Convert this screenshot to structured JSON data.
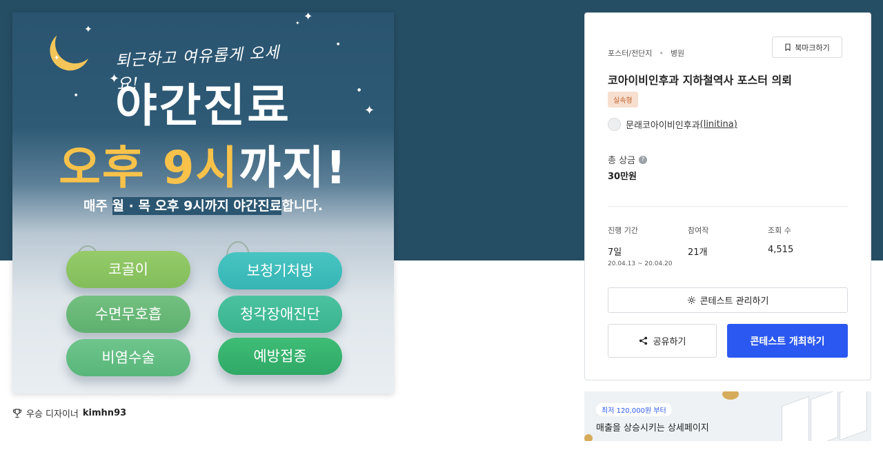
{
  "poster": {
    "tagline": "퇴근하고 여유롭게 오세요!",
    "headline_line1": "야간진료",
    "headline_line2_yellow": "오후 9시",
    "headline_line2_white": "까지!",
    "subline_pre": "매주 ",
    "subline_highlight": "월 · 목 오후 9시까지 야간진료",
    "subline_post": "합니다.",
    "services_left": [
      "코골이",
      "수면무호흡",
      "비염수술"
    ],
    "services_right": [
      "보청기처방",
      "청각장애진단",
      "예방접종"
    ]
  },
  "winner": {
    "label": "우승 디자이너",
    "designer": "kimhn93"
  },
  "contest": {
    "category": "포스터/전단지",
    "subcategory": "병원",
    "bookmark_label": "북마크하기",
    "title": "코아이비인후과 지하철역사 포스터 의뢰",
    "badge": "실속형",
    "host_name": "문래코아이비인후과",
    "host_id": "(linitina)",
    "prize_label": "총 상금",
    "prize_value": "30만원",
    "stats": [
      {
        "label": "진행 기간",
        "value": "7일",
        "sub": "20.04.13 ~ 20.04.20"
      },
      {
        "label": "참여작",
        "value": "21개",
        "sub": ""
      },
      {
        "label": "조회 수",
        "value": "4,515",
        "sub": ""
      }
    ],
    "manage_label": "콘테스트 관리하기",
    "share_label": "공유하기",
    "host_contest_label": "콘테스트 개최하기"
  },
  "ad": {
    "pill": "최저 120,000원 부터",
    "text": "매출을 상승시키는 상세페이지"
  },
  "colors": {
    "hero_band": "#254d63",
    "primary_button": "#2b58f0",
    "badge_bg": "#f7dfcf",
    "badge_text": "#c0602b",
    "poster_yellow": "#f8c24a"
  }
}
